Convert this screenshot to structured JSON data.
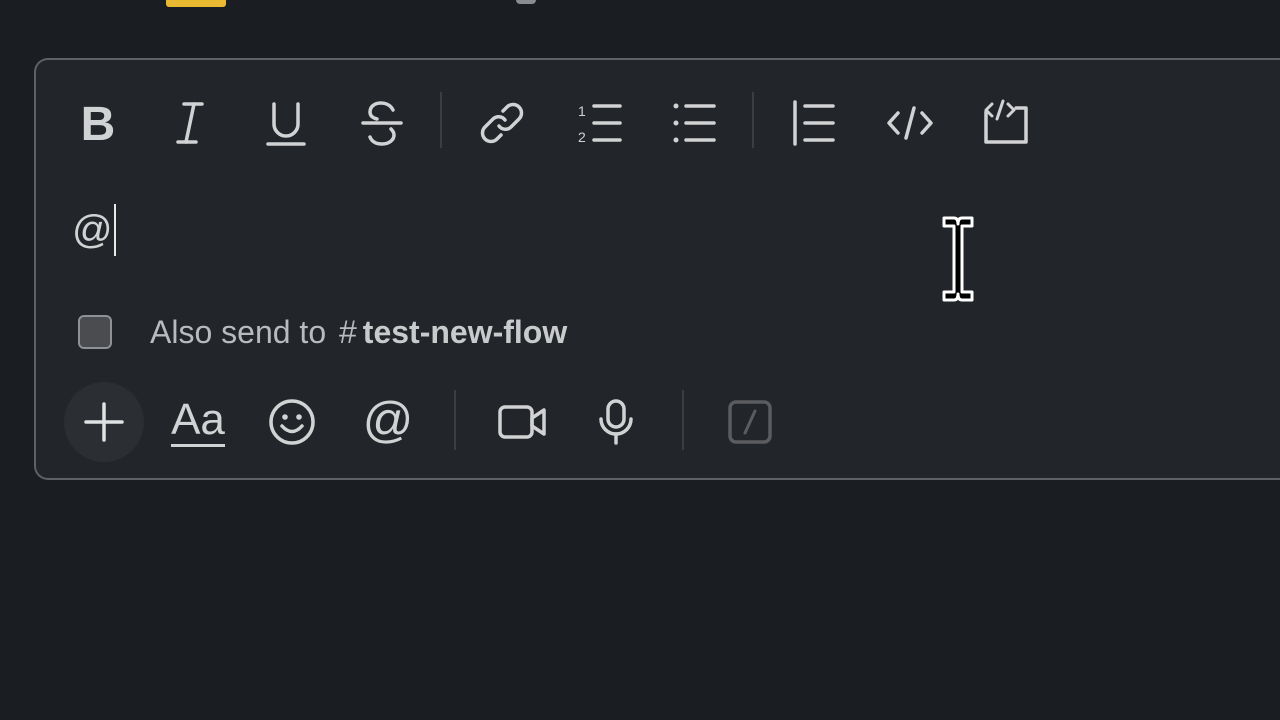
{
  "composer": {
    "text": "@",
    "toolbar": [
      {
        "name": "bold-icon",
        "label": "B"
      },
      {
        "name": "italic-icon",
        "label": "I"
      },
      {
        "name": "underline-icon",
        "label": "U"
      },
      {
        "name": "strikethrough-icon",
        "label": "S"
      },
      {
        "name": "link-icon"
      },
      {
        "name": "ordered-list-icon"
      },
      {
        "name": "bulleted-list-icon"
      },
      {
        "name": "blockquote-icon"
      },
      {
        "name": "code-icon"
      },
      {
        "name": "code-block-icon"
      }
    ],
    "also_send": {
      "prefix": "Also send to",
      "hash": "#",
      "channel": "test-new-flow",
      "checked": false
    },
    "bottom_toolbar": {
      "format_label": "Aa",
      "items": [
        "plus-icon",
        "formatting-icon",
        "emoji-icon",
        "mention-icon",
        "video-icon",
        "microphone-icon",
        "slash-command-icon"
      ]
    }
  },
  "colors": {
    "background": "#1a1d21",
    "composer_bg": "#222529",
    "icon": "#d1d2d3",
    "accent_highlight": "#e8b931"
  }
}
